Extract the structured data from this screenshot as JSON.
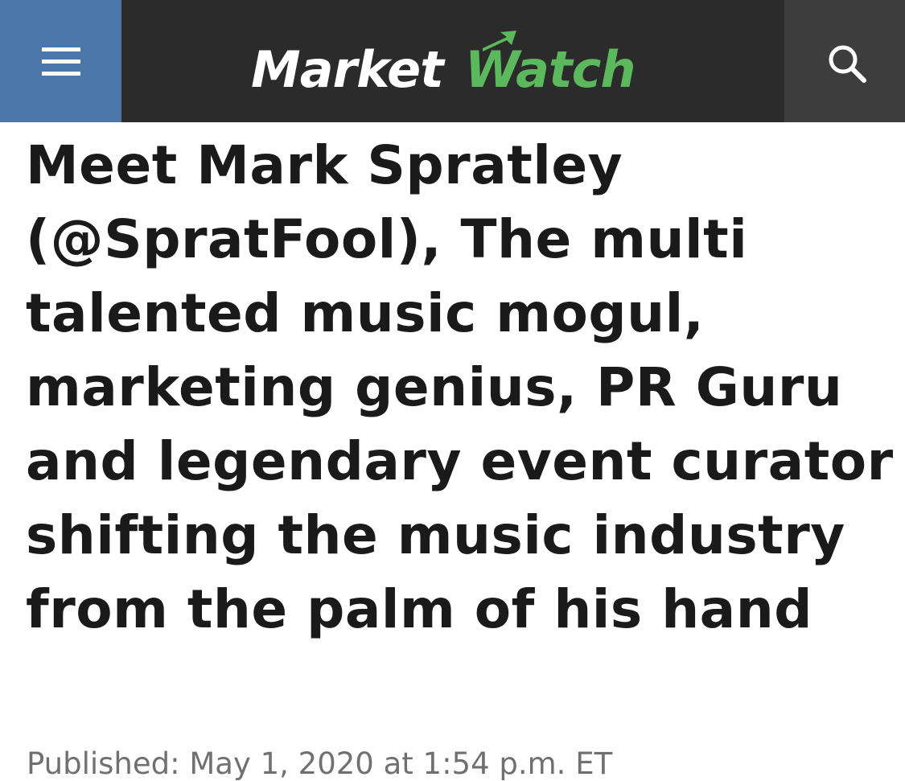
{
  "header": {
    "menu_icon": "hamburger-menu-icon",
    "logo": {
      "part1": "Market",
      "part2": "Watch",
      "colors": {
        "part1": "#ffffff",
        "part2": "#5cb85c"
      }
    },
    "search_icon": "search-icon",
    "colors": {
      "bar": "#2b2b2b",
      "menu_button": "#4a76a8",
      "search_button": "#3d3d3d"
    }
  },
  "article": {
    "headline": "Meet Mark Spratley (@SpratFool), The multi talented music mogul, marketing genius, PR Guru and legendary event curator shifting the music industry from the palm of his hand",
    "published": "Published: May 1, 2020 at 1:54 p.m. ET"
  }
}
